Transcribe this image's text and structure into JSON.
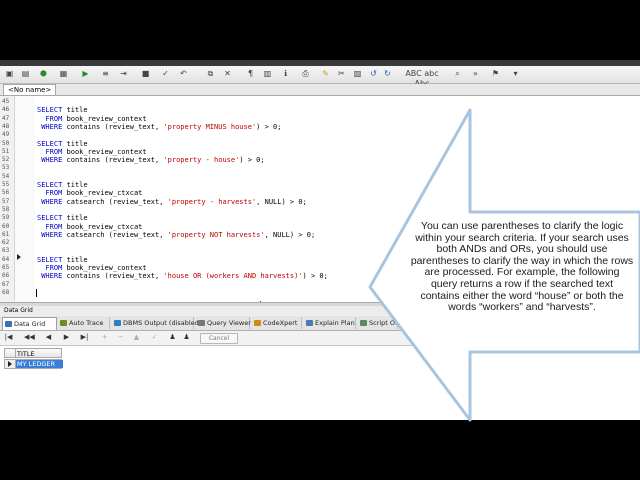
{
  "doc_tab": "<No name>",
  "editor": {
    "lines": [
      {
        "n": "45",
        "segs": []
      },
      {
        "n": "46",
        "segs": [
          {
            "t": "SELECT",
            "k": "kw"
          },
          {
            "t": " title"
          }
        ]
      },
      {
        "n": "47",
        "segs": [
          {
            "t": "  FROM",
            "k": "kw"
          },
          {
            "t": " book_review_context"
          }
        ]
      },
      {
        "n": "48",
        "segs": [
          {
            "t": " WHERE",
            "k": "kw"
          },
          {
            "t": " contains (review_text, "
          },
          {
            "t": "'property MINUS house'",
            "k": "str"
          },
          {
            "t": ") > 0;"
          }
        ]
      },
      {
        "n": "49",
        "segs": []
      },
      {
        "n": "50",
        "segs": [
          {
            "t": "SELECT",
            "k": "kw"
          },
          {
            "t": " title"
          }
        ]
      },
      {
        "n": "51",
        "segs": [
          {
            "t": "  FROM",
            "k": "kw"
          },
          {
            "t": " book_review_context"
          }
        ]
      },
      {
        "n": "52",
        "segs": [
          {
            "t": " WHERE",
            "k": "kw"
          },
          {
            "t": " contains (review_text, "
          },
          {
            "t": "'property - house'",
            "k": "str"
          },
          {
            "t": ") > 0;"
          }
        ]
      },
      {
        "n": "53",
        "segs": []
      },
      {
        "n": "54",
        "segs": []
      },
      {
        "n": "55",
        "segs": [
          {
            "t": "SELECT",
            "k": "kw"
          },
          {
            "t": " title"
          }
        ]
      },
      {
        "n": "56",
        "segs": [
          {
            "t": "  FROM",
            "k": "kw"
          },
          {
            "t": " book_review_ctxcat"
          }
        ]
      },
      {
        "n": "57",
        "segs": [
          {
            "t": " WHERE",
            "k": "kw"
          },
          {
            "t": " catsearch (review_text, "
          },
          {
            "t": "'property - harvests'",
            "k": "str"
          },
          {
            "t": ", NULL) > 0;"
          }
        ]
      },
      {
        "n": "58",
        "segs": []
      },
      {
        "n": "59",
        "segs": [
          {
            "t": "SELECT",
            "k": "kw"
          },
          {
            "t": " title"
          }
        ]
      },
      {
        "n": "60",
        "segs": [
          {
            "t": "  FROM",
            "k": "kw"
          },
          {
            "t": " book_review_ctxcat"
          }
        ]
      },
      {
        "n": "61",
        "segs": [
          {
            "t": " WHERE",
            "k": "kw"
          },
          {
            "t": " catsearch (review_text, "
          },
          {
            "t": "'property NOT harvests'",
            "k": "str"
          },
          {
            "t": ", NULL) > 0;"
          }
        ]
      },
      {
        "n": "62",
        "segs": []
      },
      {
        "n": "63",
        "segs": []
      },
      {
        "n": "64",
        "segs": [
          {
            "t": "SELECT",
            "k": "kw"
          },
          {
            "t": " title"
          }
        ]
      },
      {
        "n": "65",
        "segs": [
          {
            "t": "  FROM",
            "k": "kw"
          },
          {
            "t": " book_review_context"
          }
        ]
      },
      {
        "n": "66",
        "segs": [
          {
            "t": " WHERE",
            "k": "kw"
          },
          {
            "t": " contains (review_text, "
          },
          {
            "t": "'house OR (workers AND harvests)'",
            "k": "str"
          },
          {
            "t": ") > 0;"
          }
        ]
      },
      {
        "n": "67",
        "segs": []
      },
      {
        "n": "68",
        "segs": []
      }
    ]
  },
  "data_grid_label": "Data Grid",
  "output_tabs": [
    {
      "label": "Data Grid",
      "color": "#3a6fb8",
      "active": true
    },
    {
      "label": "Auto Trace",
      "color": "#6b8e23"
    },
    {
      "label": "DBMS Output (disabled)",
      "color": "#2f7fbf"
    },
    {
      "label": "Query Viewer",
      "color": "#777777"
    },
    {
      "label": "CodeXpert",
      "color": "#d08a1a"
    },
    {
      "label": "Explain Plan",
      "color": "#4a7ab8"
    },
    {
      "label": "Script Outp",
      "color": "#5c8a5c"
    }
  ],
  "cancel_label": "Cancel",
  "grid": {
    "column": "TITLE",
    "rows": [
      "MY LEDGER"
    ]
  },
  "callout_text": "You can use parentheses to clarify the logic within your search criteria. If your search uses both ANDs and ORs, you should use parentheses to clarify the way in which the rows are processed. For example, the following query returns a row if the searched text contains either the word “house” or both the words “workers” and “harvests”.",
  "colors": {
    "callout_fill": "#ffffff",
    "callout_edge": "#a9c4df",
    "keyword": "#0000cc",
    "string": "#c00000",
    "selection": "#3a7ed8"
  }
}
